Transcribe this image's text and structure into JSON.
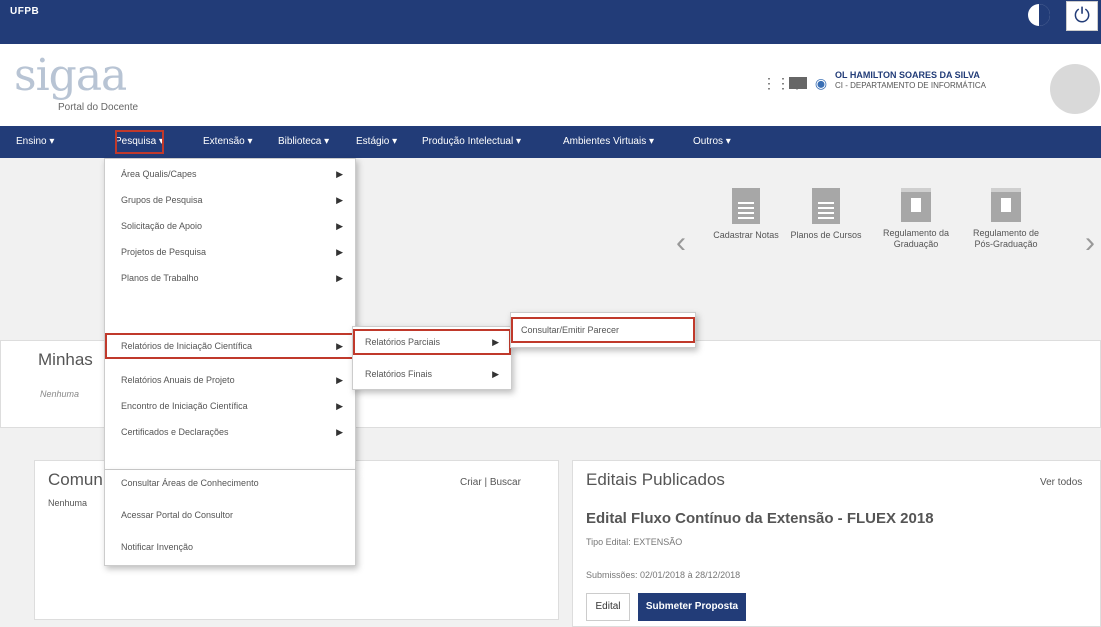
{
  "topbar": {
    "institution": "UFPB"
  },
  "header": {
    "logo_text": "sigaa",
    "logo_subtitle": "Portal do Docente",
    "user_name": "OL HAMILTON SOARES DA SILVA",
    "user_dept": "CI - DEPARTAMENTO DE INFORMÁTICA",
    "icons": [
      "apps-icon",
      "mail-icon",
      "chat-icon"
    ]
  },
  "nav": {
    "items": [
      {
        "label": "Ensino ▾"
      },
      {
        "label": "Pesquisa ▾"
      },
      {
        "label": "Extensão ▾"
      },
      {
        "label": "Biblioteca ▾"
      },
      {
        "label": "Estágio ▾"
      },
      {
        "label": "Produção Intelectual ▾"
      },
      {
        "label": "Ambientes Virtuais ▾"
      },
      {
        "label": "Outros ▾"
      }
    ]
  },
  "menu_pesquisa": {
    "items": [
      {
        "label": "Área Qualis/Capes",
        "has_sub": true
      },
      {
        "label": "Grupos de Pesquisa",
        "has_sub": true
      },
      {
        "label": "Solicitação de Apoio",
        "has_sub": true
      },
      {
        "label": "Projetos de Pesquisa",
        "has_sub": true
      },
      {
        "label": "Planos de Trabalho",
        "has_sub": true
      },
      {
        "label": "Relatórios de Iniciação Científica",
        "has_sub": true
      },
      {
        "label": "Relatórios Anuais de Projeto",
        "has_sub": true
      },
      {
        "label": "Encontro de Iniciação Científica",
        "has_sub": true
      },
      {
        "label": "Certificados e Declarações",
        "has_sub": true
      },
      {
        "label": "Consultar Áreas de Conhecimento",
        "has_sub": false
      },
      {
        "label": "Acessar Portal do Consultor",
        "has_sub": false
      },
      {
        "label": "Notificar Invenção",
        "has_sub": false
      }
    ]
  },
  "menu_relatorios": {
    "items": [
      {
        "label": "Relatórios Parciais"
      },
      {
        "label": "Relatórios Finais"
      }
    ]
  },
  "menu_parciais": {
    "items": [
      {
        "label": "Consultar/Emitir Parecer"
      }
    ]
  },
  "arrow_glyph": "▶",
  "shortcuts": {
    "prev": "‹",
    "next": "›",
    "items": [
      {
        "label": "Cadastrar Notas",
        "icon": "document-icon"
      },
      {
        "label": "Planos de Cursos",
        "icon": "document-icon"
      },
      {
        "label": "Regulamento da Graduação",
        "icon": "book-icon"
      },
      {
        "label": "Regulamento de Pós-Graduação",
        "icon": "book-icon"
      }
    ]
  },
  "minhas": {
    "title": "Minhas",
    "empty": "Nenhuma"
  },
  "comunidades": {
    "title": "Comun",
    "empty": "Nenhuma",
    "actions": "Criar | Buscar"
  },
  "editais": {
    "title": "Editais Publicados",
    "ver_todos": "Ver todos",
    "edital_name": "Edital Fluxo Contínuo da Extensão - FLUEX 2018",
    "tipo": "Tipo Edital: EXTENSÃO",
    "submissoes": "Submissões: 02/01/2018 à 28/12/2018",
    "edital_button": "Edital",
    "submeter_button": "Submeter Proposta"
  },
  "colors": {
    "primary": "#223c78",
    "highlight": "#c0392b"
  }
}
